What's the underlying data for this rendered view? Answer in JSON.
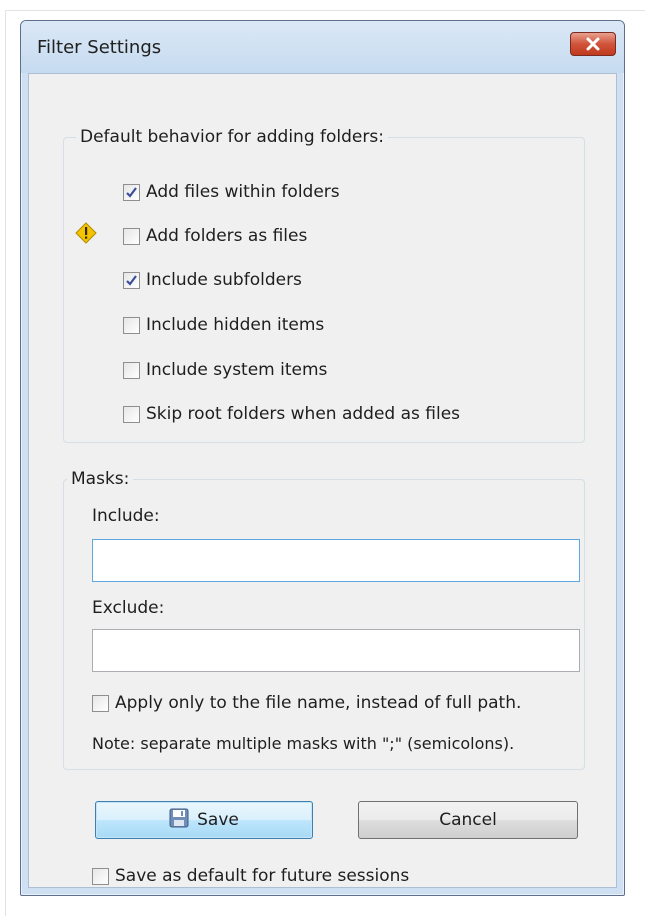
{
  "window": {
    "title": "Filter Settings"
  },
  "behavior": {
    "legend": "Default behavior for adding folders:",
    "options": [
      {
        "label": "Add files within folders",
        "checked": true
      },
      {
        "label": "Add folders as files",
        "checked": false,
        "warning": true
      },
      {
        "label": "Include subfolders",
        "checked": true
      },
      {
        "label": "Include hidden items",
        "checked": false
      },
      {
        "label": "Include system items",
        "checked": false
      },
      {
        "label": "Skip root folders when added as files",
        "checked": false
      }
    ]
  },
  "masks": {
    "legend": "Masks:",
    "include_label": "Include:",
    "include_value": "",
    "exclude_label": "Exclude:",
    "exclude_value": "",
    "apply_label": "Apply only to the file name, instead of full path.",
    "apply_checked": false,
    "note": "Note: separate multiple masks with \";\" (semicolons)."
  },
  "buttons": {
    "save_label": "Save",
    "cancel_label": "Cancel"
  },
  "save_default": {
    "label": "Save as default for future sessions",
    "checked": false
  },
  "colors": {
    "close_button": "#c03a1e",
    "default_button_border": "#3c7fb1",
    "warning_icon": "#f5c400"
  }
}
